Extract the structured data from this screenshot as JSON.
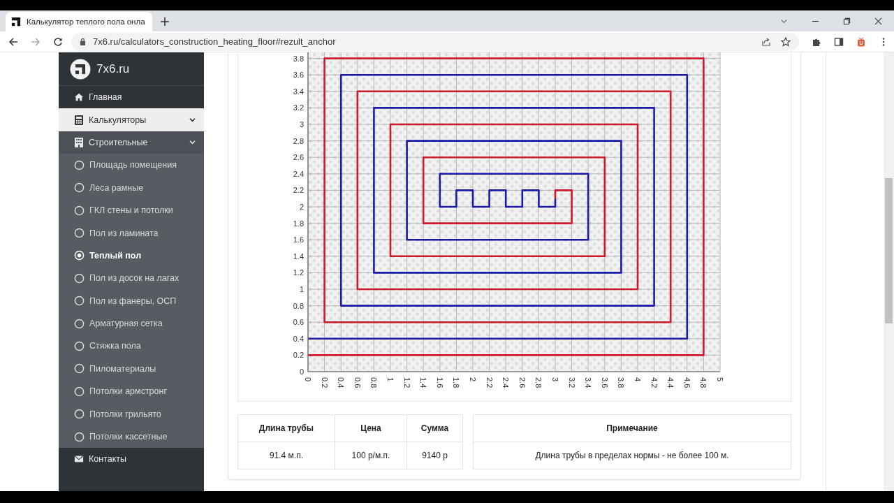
{
  "window": {
    "tab_title": "Калькулятор теплого пола онла",
    "url": "7x6.ru/calculators_construction_heating_floor#rezult_anchor"
  },
  "sidebar": {
    "logo": "7x6.ru",
    "items": [
      {
        "label": "Главная",
        "kind": "link"
      },
      {
        "label": "Калькуляторы",
        "kind": "group",
        "expanded": true,
        "children": [
          {
            "label": "Строительные",
            "kind": "group",
            "expanded": true,
            "children": [
              {
                "label": "Площадь помещения",
                "kind": "radio",
                "selected": false
              },
              {
                "label": "Леса рамные",
                "kind": "radio",
                "selected": false
              },
              {
                "label": "ГКЛ стены и потолки",
                "kind": "radio",
                "selected": false
              },
              {
                "label": "Пол из ламината",
                "kind": "radio",
                "selected": false
              },
              {
                "label": "Теплый пол",
                "kind": "radio",
                "selected": true
              },
              {
                "label": "Пол из досок на лагах",
                "kind": "radio",
                "selected": false
              },
              {
                "label": "Пол из фанеры, ОСП",
                "kind": "radio",
                "selected": false
              },
              {
                "label": "Арматурная сетка",
                "kind": "radio",
                "selected": false
              },
              {
                "label": "Стяжка пола",
                "kind": "radio",
                "selected": false
              },
              {
                "label": "Пиломатериалы",
                "kind": "radio",
                "selected": false
              },
              {
                "label": "Потолки армстронг",
                "kind": "radio",
                "selected": false
              },
              {
                "label": "Потолки грильято",
                "kind": "radio",
                "selected": false
              },
              {
                "label": "Потолки кассетные",
                "kind": "radio",
                "selected": false
              }
            ]
          }
        ]
      },
      {
        "label": "Контакты",
        "kind": "link"
      }
    ]
  },
  "plan": {
    "y_ticks": [
      "3.8",
      "3.6",
      "3.4",
      "3.2",
      "3",
      "2.8",
      "2.6",
      "2.4",
      "2.2",
      "2",
      "1.8",
      "1.6",
      "1.4",
      "1.2",
      "1",
      "0.8",
      "0.6",
      "0.4",
      "0.2",
      "0"
    ],
    "x_ticks": [
      "0",
      "0.2",
      "0.4",
      "0.6",
      "0.8",
      "1",
      "1.2",
      "1.4",
      "1.6",
      "1.8",
      "2",
      "2.2",
      "2.4",
      "2.6",
      "2.8",
      "3",
      "3.2",
      "3.4",
      "3.6",
      "3.8",
      "4",
      "4.2",
      "4.4",
      "4.6",
      "4.8",
      "5"
    ]
  },
  "cost_table": {
    "columns": [
      "Длина трубы",
      "Цена",
      "Сумма"
    ],
    "rows": [
      [
        "91.4 м.п.",
        "100 р/м.п.",
        "9140 р"
      ]
    ]
  },
  "note_table": {
    "columns": [
      "Примечание"
    ],
    "rows": [
      [
        "Длина трубы в пределах нормы - не более 100 м."
      ]
    ]
  }
}
